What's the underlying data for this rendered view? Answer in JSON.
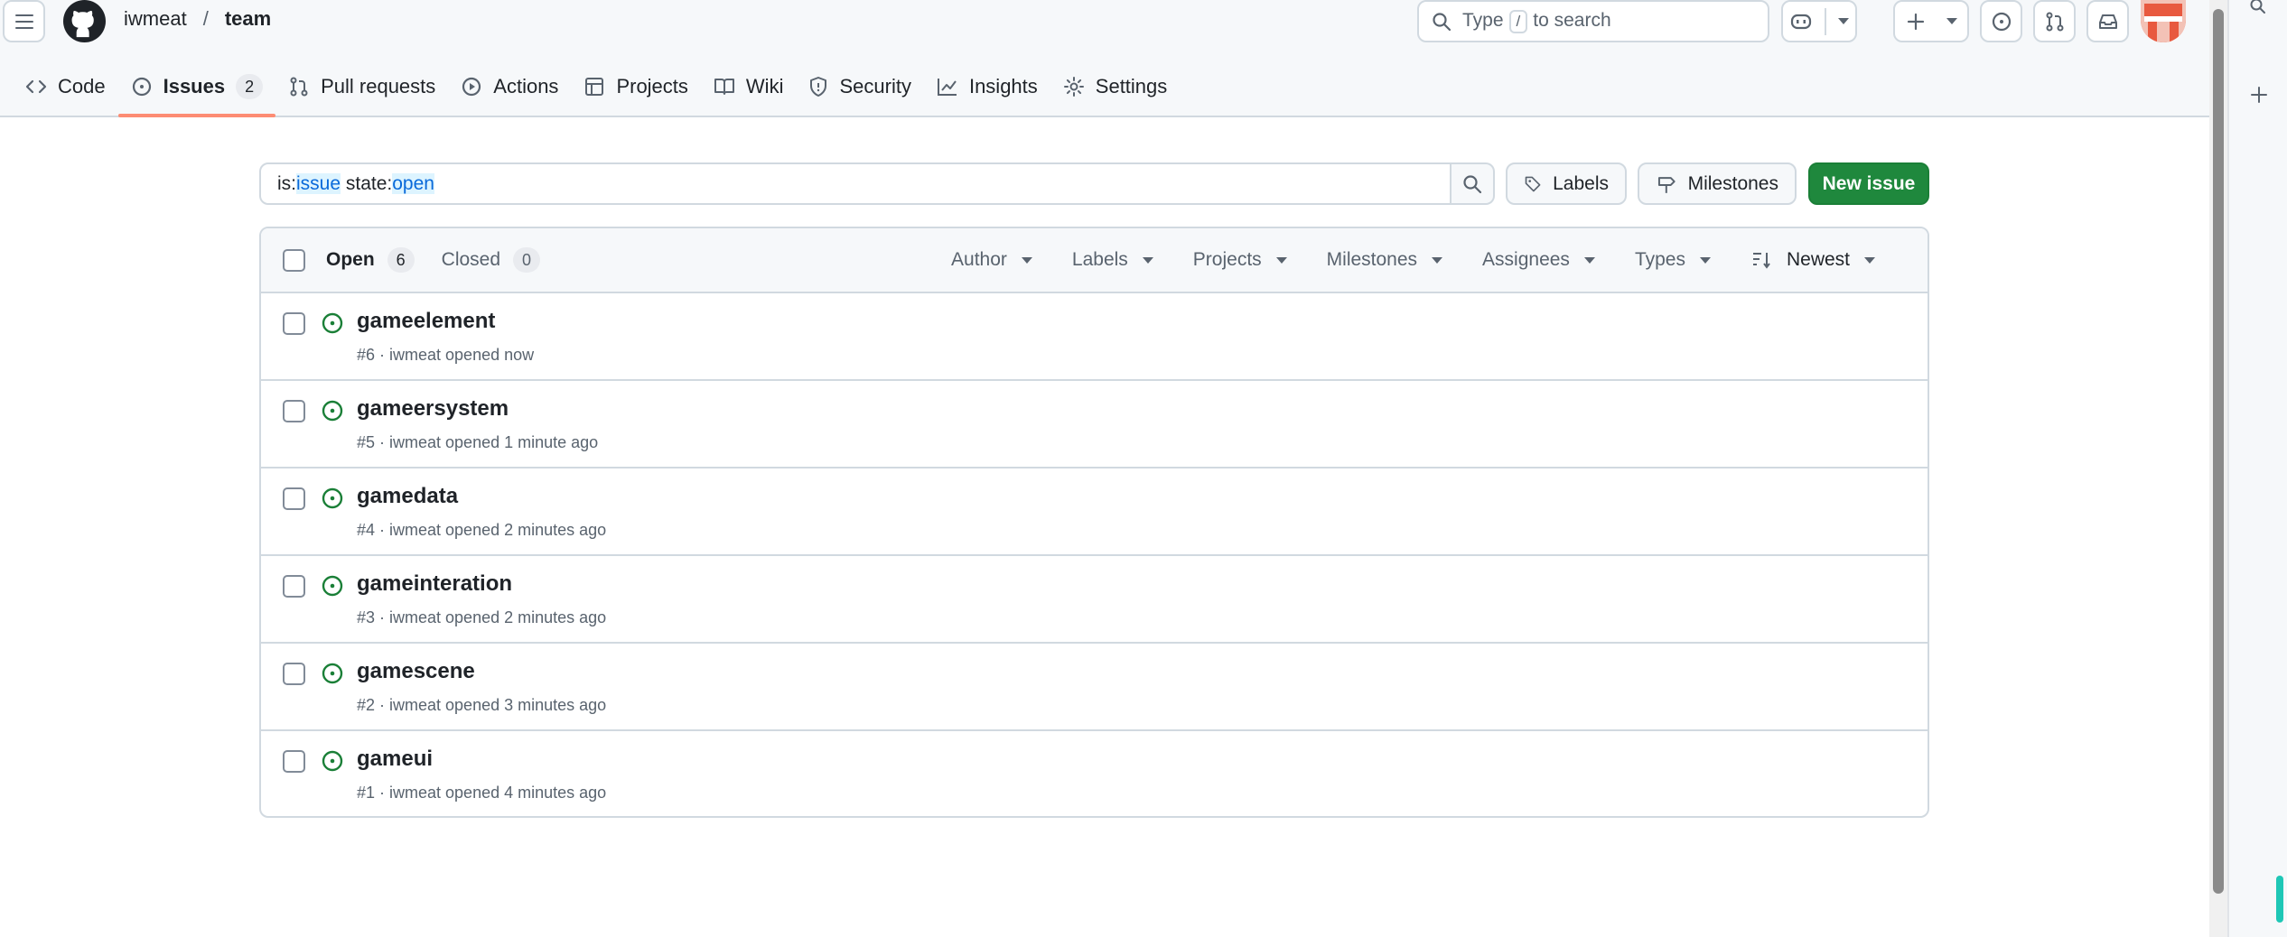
{
  "header": {
    "owner": "iwmeat",
    "separator": "/",
    "repo": "team",
    "search_prefix": "Type",
    "search_key": "/",
    "search_suffix": "to search"
  },
  "repo_nav": {
    "items": [
      {
        "label": "Code",
        "icon": "code-icon"
      },
      {
        "label": "Issues",
        "icon": "issue-opened-icon",
        "count": "2",
        "selected": true
      },
      {
        "label": "Pull requests",
        "icon": "git-pull-request-icon"
      },
      {
        "label": "Actions",
        "icon": "play-icon"
      },
      {
        "label": "Projects",
        "icon": "table-icon"
      },
      {
        "label": "Wiki",
        "icon": "book-icon"
      },
      {
        "label": "Security",
        "icon": "shield-icon"
      },
      {
        "label": "Insights",
        "icon": "graph-icon"
      },
      {
        "label": "Settings",
        "icon": "gear-icon"
      }
    ]
  },
  "toolbar": {
    "query_prefix": "is:",
    "query_token1": "issue",
    "query_mid": " state:",
    "query_token2": "open",
    "labels_label": "Labels",
    "milestones_label": "Milestones",
    "new_issue_label": "New issue"
  },
  "list_header": {
    "open_label": "Open",
    "open_count": "6",
    "closed_label": "Closed",
    "closed_count": "0",
    "filters": [
      "Author",
      "Labels",
      "Projects",
      "Milestones",
      "Assignees",
      "Types"
    ],
    "sort_label": "Newest"
  },
  "issues": [
    {
      "title": "gameelement",
      "meta": "#6 · iwmeat opened now"
    },
    {
      "title": "gameersystem",
      "meta": "#5 · iwmeat opened 1 minute ago"
    },
    {
      "title": "gamedata",
      "meta": "#4 · iwmeat opened 2 minutes ago"
    },
    {
      "title": "gameinteration",
      "meta": "#3 · iwmeat opened 2 minutes ago"
    },
    {
      "title": "gamescene",
      "meta": "#2 · iwmeat opened 3 minutes ago"
    },
    {
      "title": "gameui",
      "meta": "#1 · iwmeat opened 4 minutes ago"
    }
  ],
  "colors": {
    "open_issue": "#1a7f37",
    "primary_button": "#1f883d",
    "selected_tab_underline": "#fd8c73",
    "link_blue": "#0969da"
  }
}
